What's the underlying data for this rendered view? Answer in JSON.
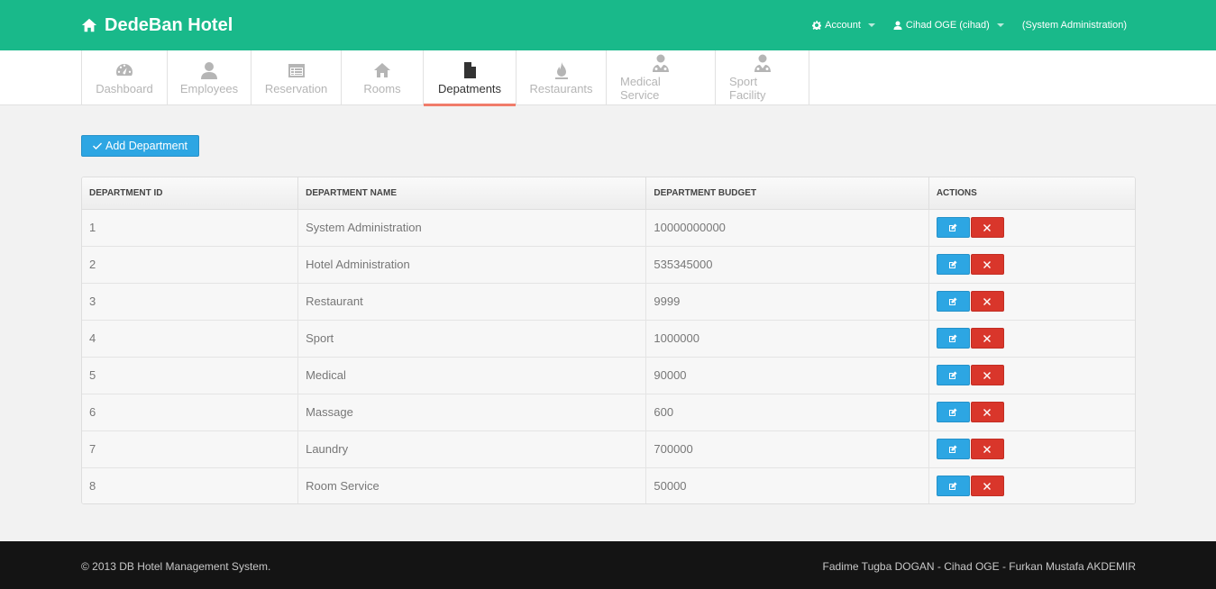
{
  "header": {
    "brand": "DedeBan Hotel",
    "account_label": "Account",
    "user_label": "Cihad OGE (cihad)",
    "role_label": "(System Administration)"
  },
  "tabs": [
    {
      "label": "Dashboard",
      "icon": "dashboard-icon"
    },
    {
      "label": "Employees",
      "icon": "user-icon"
    },
    {
      "label": "Reservation",
      "icon": "calendar-list-icon"
    },
    {
      "label": "Rooms",
      "icon": "home-icon"
    },
    {
      "label": "Depatments",
      "icon": "file-icon",
      "active": true
    },
    {
      "label": "Restaurants",
      "icon": "fire-icon"
    },
    {
      "label": "Medical Service",
      "icon": "doctor-icon"
    },
    {
      "label": "Sport Facility",
      "icon": "doctor-icon"
    }
  ],
  "toolbar": {
    "add_label": "Add Department"
  },
  "table": {
    "headers": [
      "DEPARTMENT ID",
      "DEPARTMENT NAME",
      "DEPARTMENT BUDGET",
      "ACTIONS"
    ],
    "rows": [
      {
        "id": "1",
        "name": "System Administration",
        "budget": "10000000000"
      },
      {
        "id": "2",
        "name": "Hotel Administration",
        "budget": "535345000"
      },
      {
        "id": "3",
        "name": "Restaurant",
        "budget": "9999"
      },
      {
        "id": "4",
        "name": "Sport",
        "budget": "1000000"
      },
      {
        "id": "5",
        "name": "Medical",
        "budget": "90000"
      },
      {
        "id": "6",
        "name": "Massage",
        "budget": "600"
      },
      {
        "id": "7",
        "name": "Laundry",
        "budget": "700000"
      },
      {
        "id": "8",
        "name": "Room Service",
        "budget": "50000"
      }
    ]
  },
  "footer": {
    "copyright": "© 2013 DB Hotel Management System.",
    "authors": "Fadime Tugba DOGAN - Cihad OGE - Furkan Mustafa AKDEMIR"
  },
  "colors": {
    "header_bg": "#19b98a",
    "primary": "#2da6e3",
    "danger": "#d9362b",
    "active_tab_underline": "#f07c6a",
    "footer_bg": "#141414"
  }
}
